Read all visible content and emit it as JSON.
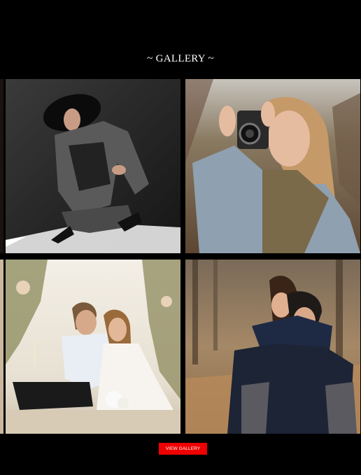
{
  "gallery": {
    "title": "~ GALLERY ~",
    "photos": [
      {
        "icon": "woman-in-hat-fashion-photo",
        "alt": "Woman in wide-brim hat crouching"
      },
      {
        "icon": "woman-with-camera-photo",
        "alt": "Smiling woman holding vintage camera"
      },
      {
        "icon": "beach-wedding-couple-photo",
        "alt": "Wedding couple sitting on sand with champagne"
      },
      {
        "icon": "piggyback-couple-photo",
        "alt": "Couple piggyback in autumn forest"
      }
    ],
    "button_label": "VIEW GALLERY"
  }
}
